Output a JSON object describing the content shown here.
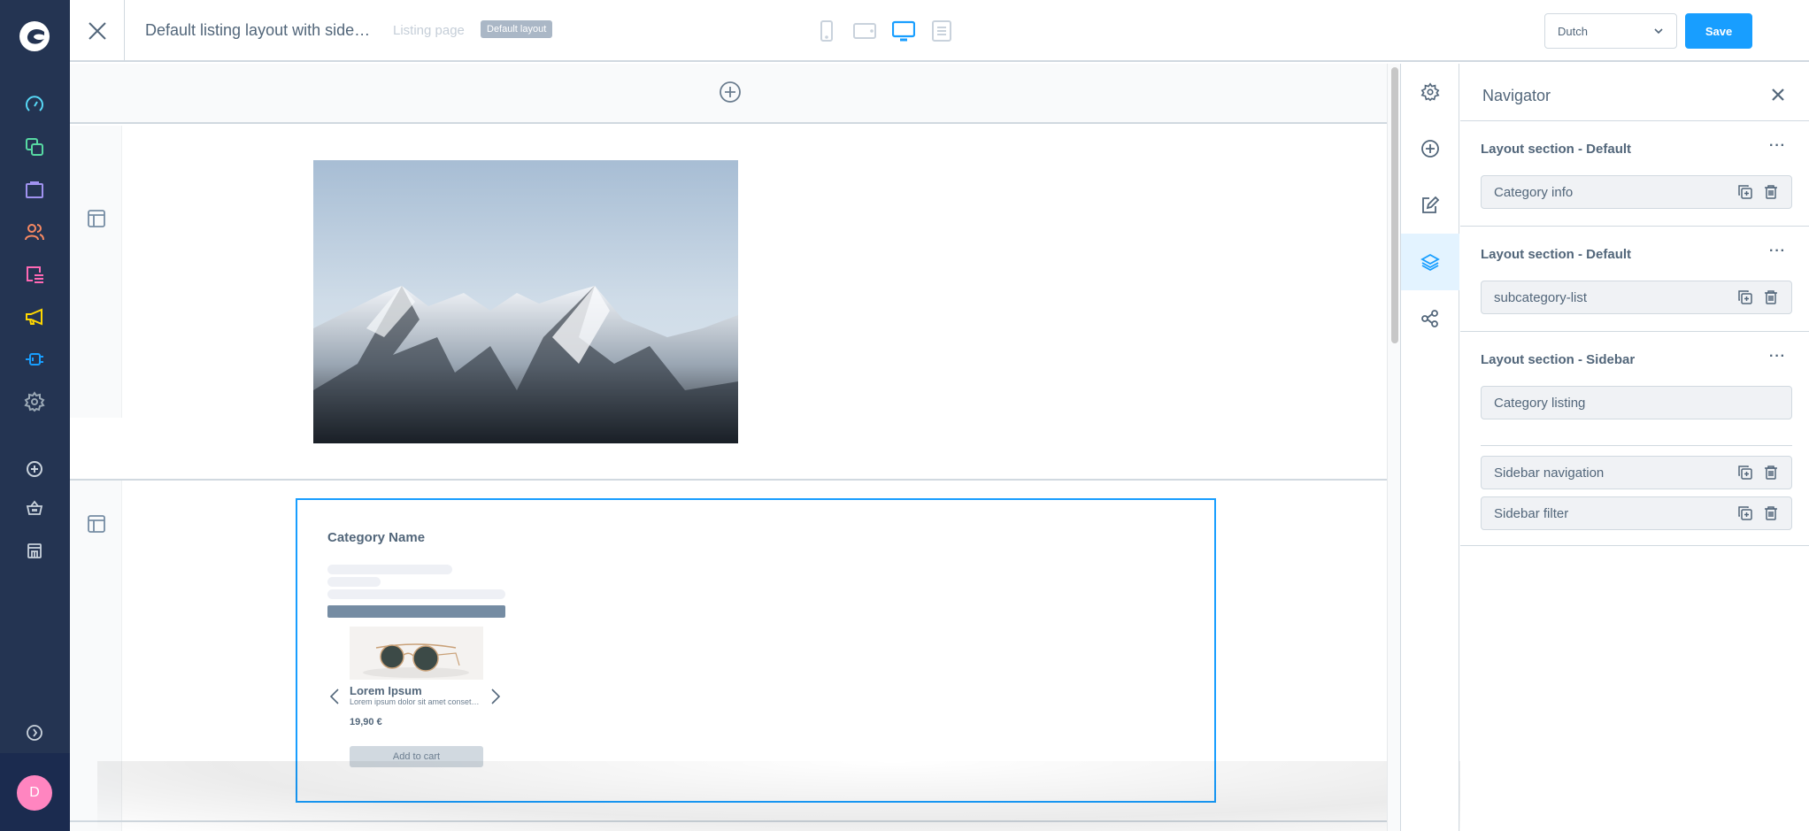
{
  "admin_nav": {
    "logo": "shopware-logo",
    "items": [
      {
        "icon": "dashboard-icon",
        "label": "Dashboard",
        "color": "#57d9f7"
      },
      {
        "icon": "catalogues-icon",
        "label": "Catalogues",
        "color": "#57d9a3"
      },
      {
        "icon": "orders-icon",
        "label": "Orders",
        "color": "#a092f0"
      },
      {
        "icon": "customers-icon",
        "label": "Customers",
        "color": "#f88962"
      },
      {
        "icon": "content-icon",
        "label": "Content",
        "color": "#ff68b4"
      },
      {
        "icon": "marketing-icon",
        "label": "Marketing",
        "color": "#ffd700"
      },
      {
        "icon": "extensions-icon",
        "label": "Extensions",
        "color": "#189eff"
      },
      {
        "icon": "settings-icon",
        "label": "Settings",
        "color": "#9aa8b5"
      }
    ],
    "sales_channel_items": [
      {
        "icon": "add-sales-channel-icon",
        "label": "Add sales channel"
      },
      {
        "icon": "basket-icon",
        "label": "Storefront"
      },
      {
        "icon": "shop-icon",
        "label": "Headless"
      }
    ],
    "collapse_icon": "chevron-circle-right-icon",
    "avatar_initial": "D",
    "avatar_color": "#ff85c0"
  },
  "topbar": {
    "title": "Default listing layout with side…",
    "page_type": "Listing page",
    "badge": "Default layout",
    "devices": [
      {
        "icon": "mobile-icon",
        "active": false
      },
      {
        "icon": "tablet-icon",
        "active": false
      },
      {
        "icon": "desktop-icon",
        "active": true
      },
      {
        "icon": "form-view-icon",
        "active": false
      }
    ],
    "language": "Dutch",
    "save_label": "Save",
    "accent": "#189eff"
  },
  "canvas": {
    "sections": [
      {
        "type": "Default",
        "blocks": [
          {
            "kind": "image",
            "description": "snowy mountain range"
          }
        ]
      },
      {
        "type": "Default",
        "blocks": [
          {
            "kind": "category-listing",
            "category_name": "Category Name",
            "product": {
              "title": "Lorem Ipsum",
              "description": "Lorem ipsum dolor sit amet conset…",
              "price": "19,90 €",
              "add_to_cart": "Add to cart"
            }
          }
        ]
      }
    ]
  },
  "side_tabs": [
    {
      "icon": "settings-icon",
      "active": false
    },
    {
      "icon": "add-block-icon",
      "active": false
    },
    {
      "icon": "edit-icon",
      "active": false
    },
    {
      "icon": "layers-icon",
      "active": true
    },
    {
      "icon": "share-icon",
      "active": false
    }
  ],
  "navigator": {
    "title": "Navigator",
    "sections": [
      {
        "label": "Layout section - Default",
        "blocks": [
          "Category info"
        ]
      },
      {
        "label": "Layout section - Default",
        "blocks": [
          "subcategory-list"
        ]
      },
      {
        "label": "Layout section - Sidebar",
        "main_blocks": [
          "Category listing"
        ],
        "sidebar_blocks": [
          "Sidebar navigation",
          "Sidebar filter"
        ]
      }
    ]
  }
}
